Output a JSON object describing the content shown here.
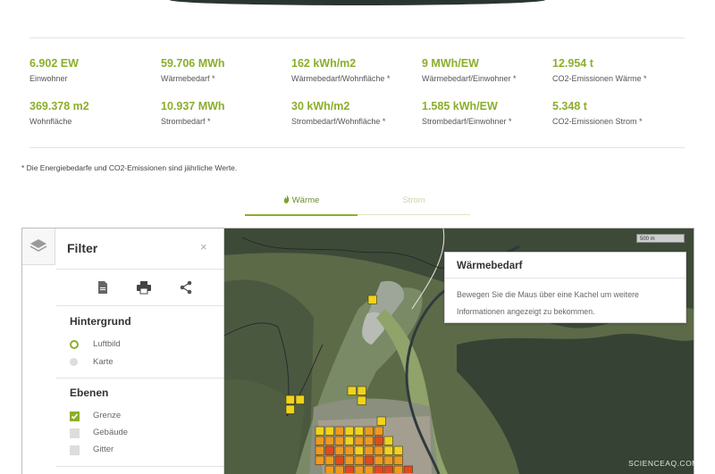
{
  "stats": [
    {
      "value": "6.902 EW",
      "label": "Einwohner"
    },
    {
      "value": "59.706 MWh",
      "label": "Wärmebedarf *"
    },
    {
      "value": "162 kWh/m2",
      "label": "Wärmebedarf/Wohnfläche *"
    },
    {
      "value": "9 MWh/EW",
      "label": "Wärmebedarf/Einwohner *"
    },
    {
      "value": "12.954 t",
      "label": "CO2-Emissionen Wärme *"
    },
    {
      "value": "369.378 m2",
      "label": "Wohnfläche"
    },
    {
      "value": "10.937 MWh",
      "label": "Strombedarf *"
    },
    {
      "value": "30 kWh/m2",
      "label": "Strombedarf/Wohnfläche *"
    },
    {
      "value": "1.585 kWh/EW",
      "label": "Strombedarf/Einwohner *"
    },
    {
      "value": "5.348 t",
      "label": "CO2-Emissionen Strom *"
    }
  ],
  "footnote": "* Die Energiebedarfe und CO2-Emissionen sind jährliche Werte.",
  "tabs": {
    "waerme": "Wärme",
    "strom": "Strom",
    "active": "waerme"
  },
  "filter": {
    "title": "Filter",
    "close": "×",
    "hintergrund_title": "Hintergrund",
    "luftbild": "Luftbild",
    "karte": "Karte",
    "selected_background": "Luftbild",
    "ebenen_title": "Ebenen",
    "grenze": "Grenze",
    "gebaeude": "Gebäude",
    "gitter": "Gitter",
    "checked_layers": [
      "Grenze"
    ]
  },
  "popup": {
    "title": "Wärmebedarf",
    "body": "Bewegen Sie die Maus über eine Kachel um weitere Informationen angezeigt zu bekommen."
  },
  "map": {
    "scale_label": "500 m"
  },
  "watermark": "SCIENCEAQ.COM",
  "colors": {
    "accent": "#8cae2c",
    "tile_yellow": "#f2d21a",
    "tile_orange": "#f09a1e",
    "tile_red": "#e24a1c"
  },
  "icons": [
    "layers-icon",
    "pdf-icon",
    "print-icon",
    "share-icon",
    "flame-icon"
  ]
}
